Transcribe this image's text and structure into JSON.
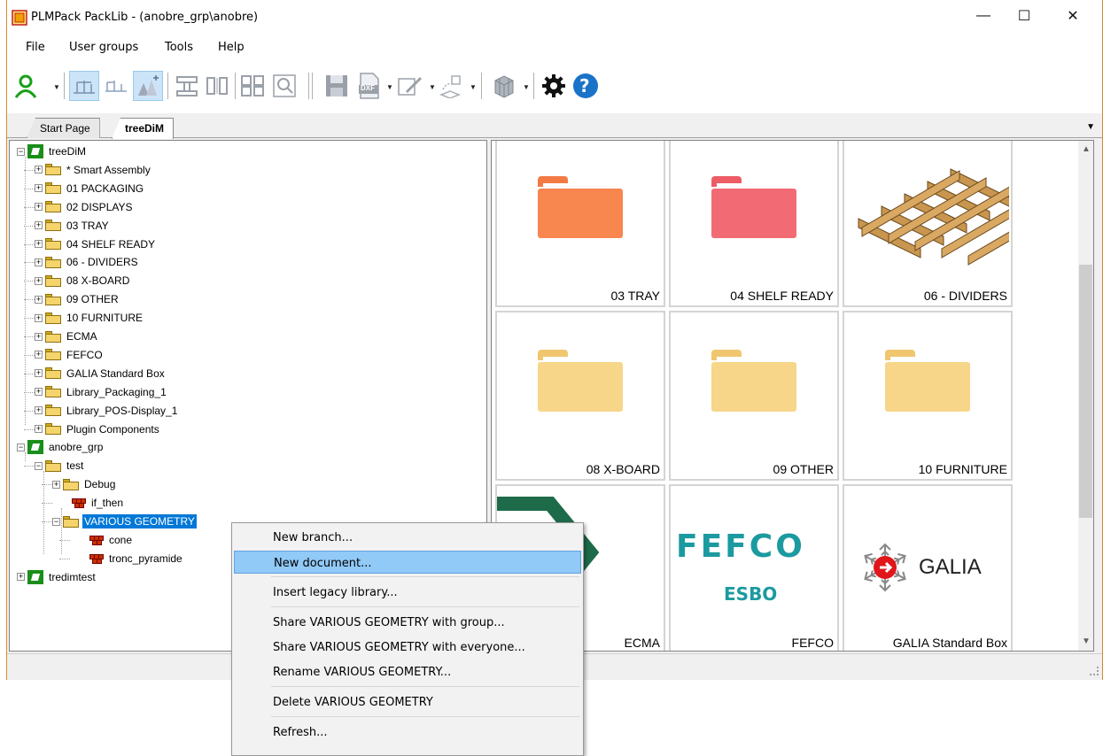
{
  "window": {
    "title": "PLMPack PackLib - (anobre_grp\\anobre)",
    "minimize": "—",
    "maximize": "☐",
    "close": "✕"
  },
  "menubar": {
    "items": [
      "File",
      "User groups",
      "Tools",
      "Help"
    ]
  },
  "toolbar": {
    "icons": [
      "user-icon",
      "tree-view-icon",
      "list-view-icon",
      "chart-view-icon",
      "component-icon",
      "split-icon",
      "grid-icon",
      "zoom-icon",
      "save-icon",
      "dxf-icon",
      "edit-icon",
      "shapes-icon",
      "pallet-icon",
      "settings-icon",
      "help-icon"
    ],
    "dxf_label": "DXF",
    "help_glyph": "?"
  },
  "tabs": [
    {
      "label": "Start Page",
      "active": false
    },
    {
      "label": "treeDiM",
      "active": true
    }
  ],
  "tree": [
    {
      "label": "treeDiM",
      "type": "root",
      "level": 0,
      "expander": "−"
    },
    {
      "label": "* Smart Assembly",
      "type": "folder",
      "level": 1,
      "expander": "+"
    },
    {
      "label": "01  PACKAGING",
      "type": "folder",
      "level": 1,
      "expander": "+"
    },
    {
      "label": "02  DISPLAYS",
      "type": "folder",
      "level": 1,
      "expander": "+"
    },
    {
      "label": "03  TRAY",
      "type": "folder",
      "level": 1,
      "expander": "+"
    },
    {
      "label": "04  SHELF READY",
      "type": "folder",
      "level": 1,
      "expander": "+"
    },
    {
      "label": "06 - DIVIDERS",
      "type": "folder",
      "level": 1,
      "expander": "+"
    },
    {
      "label": "08  X-BOARD",
      "type": "folder",
      "level": 1,
      "expander": "+"
    },
    {
      "label": "09  OTHER",
      "type": "folder",
      "level": 1,
      "expander": "+"
    },
    {
      "label": "10  FURNITURE",
      "type": "folder",
      "level": 1,
      "expander": "+"
    },
    {
      "label": "ECMA",
      "type": "folder",
      "level": 1,
      "expander": "+"
    },
    {
      "label": "FEFCO",
      "type": "folder",
      "level": 1,
      "expander": "+"
    },
    {
      "label": "GALIA Standard Box",
      "type": "folder",
      "level": 1,
      "expander": "+"
    },
    {
      "label": "Library_Packaging_1",
      "type": "folder",
      "level": 1,
      "expander": "+"
    },
    {
      "label": "Library_POS-Display_1",
      "type": "folder",
      "level": 1,
      "expander": "+"
    },
    {
      "label": "Plugin Components",
      "type": "folder",
      "level": 1,
      "expander": "+"
    },
    {
      "label": "anobre_grp",
      "type": "root",
      "level": 0,
      "expander": "−"
    },
    {
      "label": "test",
      "type": "folder",
      "level": 1,
      "expander": "−"
    },
    {
      "label": "Debug",
      "type": "folder",
      "level": 2,
      "expander": "+"
    },
    {
      "label": "if_then",
      "type": "doc",
      "level": 2,
      "expander": ""
    },
    {
      "label": "VARIOUS GEOMETRY",
      "type": "folder",
      "level": 2,
      "expander": "−",
      "selected": true
    },
    {
      "label": "cone",
      "type": "doc",
      "level": 3,
      "expander": ""
    },
    {
      "label": "tronc_pyramide",
      "type": "doc",
      "level": 3,
      "expander": ""
    },
    {
      "label": "tredimtest",
      "type": "root",
      "level": 0,
      "expander": "+"
    }
  ],
  "grid": [
    {
      "label": "03  TRAY",
      "kind": "folder",
      "color": "#f7864f",
      "tab_color": "#f47a45"
    },
    {
      "label": "04  SHELF READY",
      "kind": "folder",
      "color": "#f26b74",
      "tab_color": "#ee5c66"
    },
    {
      "label": "06 - DIVIDERS",
      "kind": "dividers"
    },
    {
      "label": "08  X-BOARD",
      "kind": "folder",
      "color": "#f7d68a",
      "tab_color": "#f0c66e"
    },
    {
      "label": "09  OTHER",
      "kind": "folder",
      "color": "#f7d68a",
      "tab_color": "#f0c66e"
    },
    {
      "label": "10  FURNITURE",
      "kind": "folder",
      "color": "#f7d68a",
      "tab_color": "#f0c66e"
    },
    {
      "label": "ECMA",
      "kind": "ecma"
    },
    {
      "label": "FEFCO",
      "kind": "fefco",
      "logo_top": "FEFCO",
      "logo_bottom": "ESBO"
    },
    {
      "label": "GALIA Standard Box",
      "kind": "galia",
      "logo_text": "GALIA"
    }
  ],
  "context_menu": [
    {
      "label": "New branch...",
      "sep_after": false,
      "hover": false
    },
    {
      "label": "New document...",
      "sep_after": true,
      "hover": true
    },
    {
      "label": "Insert legacy library...",
      "sep_after": true,
      "hover": false
    },
    {
      "label": "Share VARIOUS GEOMETRY with group...",
      "sep_after": false,
      "hover": false
    },
    {
      "label": "Share VARIOUS GEOMETRY with everyone...",
      "sep_after": false,
      "hover": false
    },
    {
      "label": "Rename VARIOUS GEOMETRY...",
      "sep_after": true,
      "hover": false
    },
    {
      "label": "Delete VARIOUS GEOMETRY",
      "sep_after": true,
      "hover": false
    },
    {
      "label": "Refresh...",
      "sep_after": false,
      "hover": false
    }
  ],
  "colors": {
    "accent": "#0078d7",
    "hover": "#91c9f7",
    "fefco_teal": "#1b9aa0",
    "galia_red": "#e0161b",
    "ecma_green": "#1e6b4a"
  }
}
